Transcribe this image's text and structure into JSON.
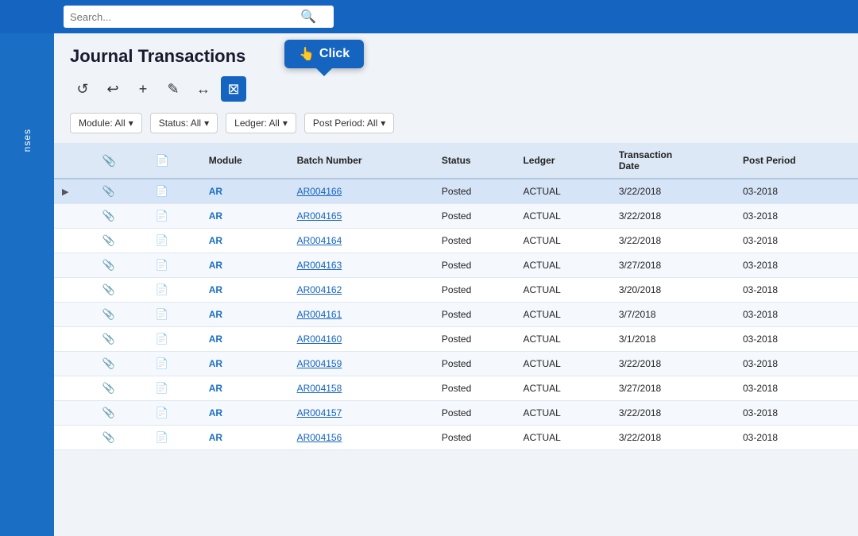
{
  "topbar": {
    "search_placeholder": "Search...",
    "search_button_label": "🔍"
  },
  "sidebar": {
    "label": "nses"
  },
  "page": {
    "title": "Journal Transactions",
    "click_label": "Click",
    "click_icon": "👆"
  },
  "toolbar": {
    "buttons": [
      {
        "id": "refresh",
        "icon": "↺",
        "label": "Refresh",
        "active": false
      },
      {
        "id": "undo",
        "icon": "↩",
        "label": "Undo",
        "active": false
      },
      {
        "id": "add",
        "icon": "+",
        "label": "Add",
        "active": false
      },
      {
        "id": "edit",
        "icon": "✎",
        "label": "Edit",
        "active": false
      },
      {
        "id": "fit",
        "icon": "↔",
        "label": "Fit Columns",
        "active": false
      },
      {
        "id": "export",
        "icon": "⊠",
        "label": "Export",
        "active": true
      }
    ]
  },
  "filters": [
    {
      "id": "module",
      "label": "Module: All"
    },
    {
      "id": "status",
      "label": "Status: All"
    },
    {
      "id": "ledger",
      "label": "Ledger: All"
    },
    {
      "id": "post_period",
      "label": "Post Period: All"
    }
  ],
  "table": {
    "headers": [
      {
        "id": "expand",
        "label": ""
      },
      {
        "id": "attach",
        "label": "📎"
      },
      {
        "id": "doc",
        "label": "📄"
      },
      {
        "id": "module",
        "label": "Module"
      },
      {
        "id": "batch_number",
        "label": "Batch Number"
      },
      {
        "id": "status",
        "label": "Status"
      },
      {
        "id": "ledger",
        "label": "Ledger"
      },
      {
        "id": "transaction_date",
        "label": "Transaction Date"
      },
      {
        "id": "post_period",
        "label": "Post Period"
      }
    ],
    "rows": [
      {
        "expand": "▶",
        "attach": "📎",
        "doc": "📄",
        "module": "AR",
        "batch_number": "AR004166",
        "status": "Posted",
        "ledger": "ACTUAL",
        "transaction_date": "3/22/2018",
        "post_period": "03-2018",
        "selected": true
      },
      {
        "expand": "",
        "attach": "📎",
        "doc": "📄",
        "module": "AR",
        "batch_number": "AR004165",
        "status": "Posted",
        "ledger": "ACTUAL",
        "transaction_date": "3/22/2018",
        "post_period": "03-2018",
        "selected": false
      },
      {
        "expand": "",
        "attach": "📎",
        "doc": "📄",
        "module": "AR",
        "batch_number": "AR004164",
        "status": "Posted",
        "ledger": "ACTUAL",
        "transaction_date": "3/22/2018",
        "post_period": "03-2018",
        "selected": false
      },
      {
        "expand": "",
        "attach": "📎",
        "doc": "📄",
        "module": "AR",
        "batch_number": "AR004163",
        "status": "Posted",
        "ledger": "ACTUAL",
        "transaction_date": "3/27/2018",
        "post_period": "03-2018",
        "selected": false
      },
      {
        "expand": "",
        "attach": "📎",
        "doc": "📄",
        "module": "AR",
        "batch_number": "AR004162",
        "status": "Posted",
        "ledger": "ACTUAL",
        "transaction_date": "3/20/2018",
        "post_period": "03-2018",
        "selected": false
      },
      {
        "expand": "",
        "attach": "📎",
        "doc": "📄",
        "module": "AR",
        "batch_number": "AR004161",
        "status": "Posted",
        "ledger": "ACTUAL",
        "transaction_date": "3/7/2018",
        "post_period": "03-2018",
        "selected": false
      },
      {
        "expand": "",
        "attach": "📎",
        "doc": "📄",
        "module": "AR",
        "batch_number": "AR004160",
        "status": "Posted",
        "ledger": "ACTUAL",
        "transaction_date": "3/1/2018",
        "post_period": "03-2018",
        "selected": false
      },
      {
        "expand": "",
        "attach": "📎",
        "doc": "📄",
        "module": "AR",
        "batch_number": "AR004159",
        "status": "Posted",
        "ledger": "ACTUAL",
        "transaction_date": "3/22/2018",
        "post_period": "03-2018",
        "selected": false
      },
      {
        "expand": "",
        "attach": "📎",
        "doc": "📄",
        "module": "AR",
        "batch_number": "AR004158",
        "status": "Posted",
        "ledger": "ACTUAL",
        "transaction_date": "3/27/2018",
        "post_period": "03-2018",
        "selected": false
      },
      {
        "expand": "",
        "attach": "📎",
        "doc": "📄",
        "module": "AR",
        "batch_number": "AR004157",
        "status": "Posted",
        "ledger": "ACTUAL",
        "transaction_date": "3/22/2018",
        "post_period": "03-2018",
        "selected": false
      },
      {
        "expand": "",
        "attach": "📎",
        "doc": "📄",
        "module": "AR",
        "batch_number": "AR004156",
        "status": "Posted",
        "ledger": "ACTUAL",
        "transaction_date": "3/22/2018",
        "post_period": "03-2018",
        "selected": false
      }
    ]
  }
}
